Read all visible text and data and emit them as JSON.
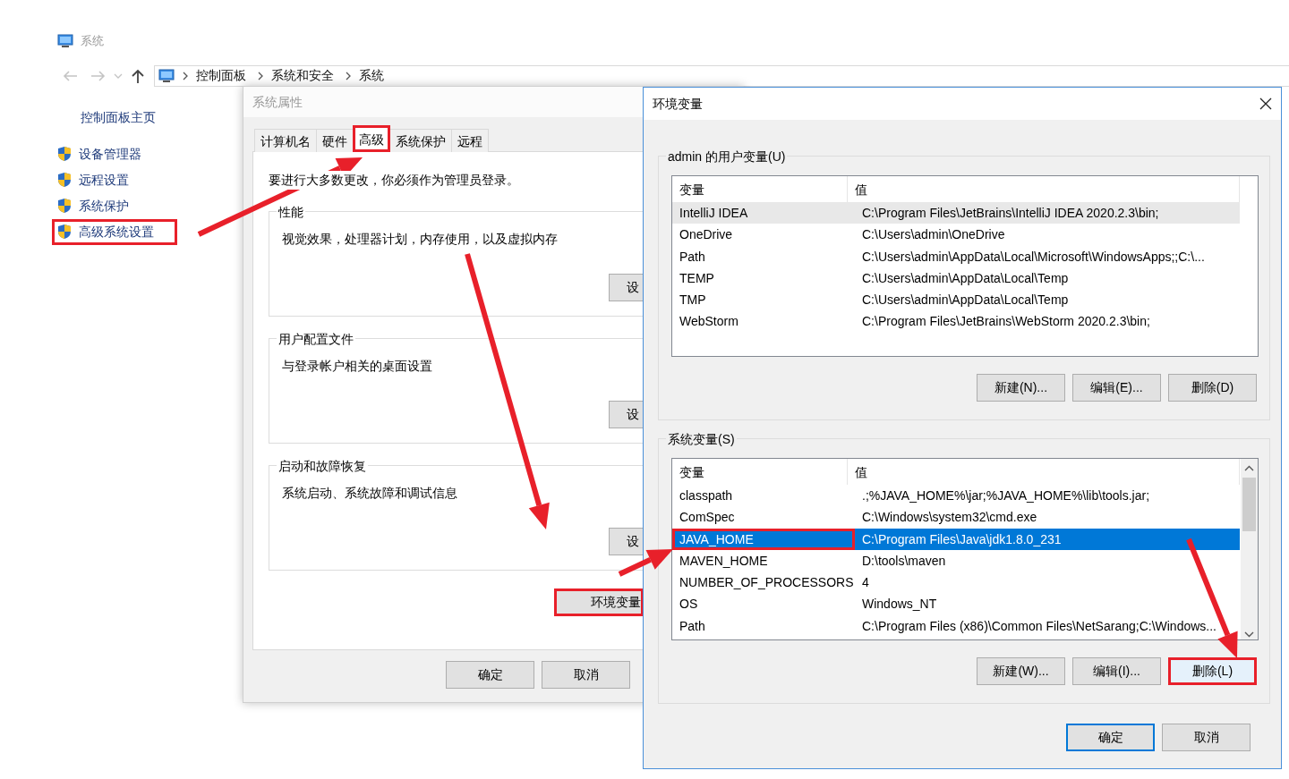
{
  "explorer": {
    "title": "系统",
    "breadcrumbs": [
      "控制面板",
      "系统和安全",
      "系统"
    ],
    "sidebar_home": "控制面板主页",
    "sidebar_items": [
      {
        "label": "设备管理器",
        "highlighted": false
      },
      {
        "label": "远程设置",
        "highlighted": false
      },
      {
        "label": "系统保护",
        "highlighted": false
      },
      {
        "label": "高级系统设置",
        "highlighted": true
      }
    ]
  },
  "system_properties": {
    "title": "系统属性",
    "tabs": [
      {
        "label": "计算机名",
        "selected": false,
        "highlighted": false
      },
      {
        "label": "硬件",
        "selected": false,
        "highlighted": false
      },
      {
        "label": "高级",
        "selected": true,
        "highlighted": true
      },
      {
        "label": "系统保护",
        "selected": false,
        "highlighted": false
      },
      {
        "label": "远程",
        "selected": false,
        "highlighted": false
      }
    ],
    "notice": "要进行大多数更改，你必须作为管理员登录。",
    "groups": [
      {
        "title": "性能",
        "description": "视觉效果，处理器计划，内存使用，以及虚拟内存",
        "button": "设"
      },
      {
        "title": "用户配置文件",
        "description": "与登录帐户相关的桌面设置",
        "button": "设"
      },
      {
        "title": "启动和故障恢复",
        "description": "系统启动、系统故障和调试信息",
        "button": "设"
      }
    ],
    "env_button": {
      "label": "环境变量",
      "highlighted": true
    },
    "buttons": [
      "确定",
      "取消"
    ]
  },
  "environment_variables": {
    "title": "环境变量",
    "user_variables": {
      "title": "admin 的用户变量(U)",
      "focused": false,
      "columns": [
        "变量",
        "值"
      ],
      "rows": [
        {
          "name": "IntelliJ IDEA",
          "value": "C:\\Program Files\\JetBrains\\IntelliJ IDEA 2020.2.3\\bin;",
          "selected": true,
          "highlighted": false
        },
        {
          "name": "OneDrive",
          "value": "C:\\Users\\admin\\OneDrive",
          "selected": false,
          "highlighted": false
        },
        {
          "name": "Path",
          "value": "C:\\Users\\admin\\AppData\\Local\\Microsoft\\WindowsApps;;C:\\...",
          "selected": false,
          "highlighted": false
        },
        {
          "name": "TEMP",
          "value": "C:\\Users\\admin\\AppData\\Local\\Temp",
          "selected": false,
          "highlighted": false
        },
        {
          "name": "TMP",
          "value": "C:\\Users\\admin\\AppData\\Local\\Temp",
          "selected": false,
          "highlighted": false
        },
        {
          "name": "WebStorm",
          "value": "C:\\Program Files\\JetBrains\\WebStorm 2020.2.3\\bin;",
          "selected": false,
          "highlighted": false
        }
      ],
      "buttons": [
        {
          "label": "新建(N)...",
          "focused": false
        },
        {
          "label": "编辑(E)...",
          "focused": false
        },
        {
          "label": "删除(D)",
          "focused": false
        }
      ]
    },
    "system_variables": {
      "title": "系统变量(S)",
      "focused": true,
      "columns": [
        "变量",
        "值"
      ],
      "rows": [
        {
          "name": "classpath",
          "value": ".;%JAVA_HOME%\\jar;%JAVA_HOME%\\lib\\tools.jar;",
          "selected": false,
          "highlighted": false
        },
        {
          "name": "ComSpec",
          "value": "C:\\Windows\\system32\\cmd.exe",
          "selected": false,
          "highlighted": false
        },
        {
          "name": "JAVA_HOME",
          "value": "C:\\Program Files\\Java\\jdk1.8.0_231",
          "selected": true,
          "highlighted": true
        },
        {
          "name": "MAVEN_HOME",
          "value": "D:\\tools\\maven",
          "selected": false,
          "highlighted": false
        },
        {
          "name": "NUMBER_OF_PROCESSORS",
          "value": "4",
          "selected": false,
          "highlighted": false
        },
        {
          "name": "OS",
          "value": "Windows_NT",
          "selected": false,
          "highlighted": false
        },
        {
          "name": "Path",
          "value": "C:\\Program Files (x86)\\Common Files\\NetSarang;C:\\Windows...",
          "selected": false,
          "highlighted": false
        }
      ],
      "buttons": [
        {
          "label": "新建(W)...",
          "focused": false,
          "highlighted": false
        },
        {
          "label": "编辑(I)...",
          "focused": false,
          "highlighted": false
        },
        {
          "label": "删除(L)",
          "focused": true,
          "highlighted": true
        }
      ]
    },
    "buttons": [
      {
        "label": "确定",
        "default": true
      },
      {
        "label": "取消",
        "default": false
      }
    ]
  },
  "annotation_arrows": true
}
